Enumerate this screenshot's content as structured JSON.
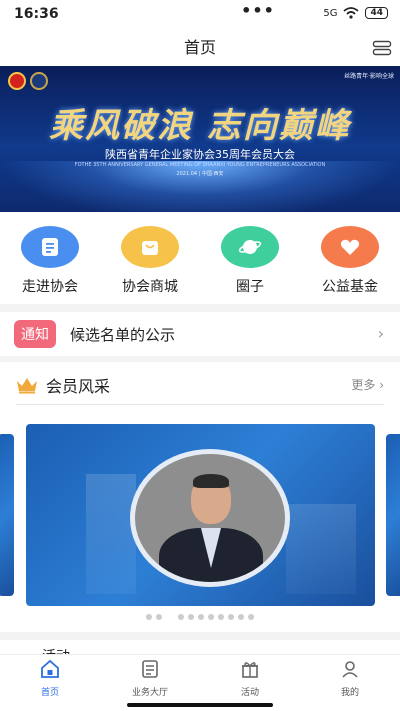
{
  "status": {
    "time": "16:36",
    "dots": "•••",
    "battery": "44",
    "signal": "5G"
  },
  "header": {
    "title": "首页"
  },
  "banner": {
    "topright": "丝路青年·影响全球",
    "calligraphy": "乘风破浪  志向巅峰",
    "subtitle": "陕西省青年企业家协会35周年会员大会",
    "english": "FOTHE 35TH ANNIVERSARY GENERAL MEETING OF SHAANXI YOUNG ENTREPRENEURS ASSOCIATION",
    "date": "2021.04 | 中国·西安"
  },
  "quick": [
    {
      "label": "走进协会",
      "icon": "info-card-icon",
      "color": "#4a8ff0"
    },
    {
      "label": "协会商城",
      "icon": "shopping-bag-icon",
      "color": "#f6c24a"
    },
    {
      "label": "圈子",
      "icon": "planet-icon",
      "color": "#3fcf9c"
    },
    {
      "label": "公益基金",
      "icon": "heart-hand-icon",
      "color": "#f57a4c"
    }
  ],
  "notice": {
    "tag": "通知",
    "text": "候选名单的公示"
  },
  "members": {
    "title": "会员风采",
    "more": "更多"
  },
  "activity": {
    "title": "活动"
  },
  "tabs": [
    {
      "label": "首页",
      "icon": "home-icon",
      "active": true
    },
    {
      "label": "业务大厅",
      "icon": "document-icon",
      "active": false
    },
    {
      "label": "活动",
      "icon": "gift-icon",
      "active": false
    },
    {
      "label": "我的",
      "icon": "person-icon",
      "active": false
    }
  ],
  "colors": {
    "accent": "#2b6fe0",
    "notice_tag": "#f2697c",
    "crown": "#f0a93a"
  }
}
